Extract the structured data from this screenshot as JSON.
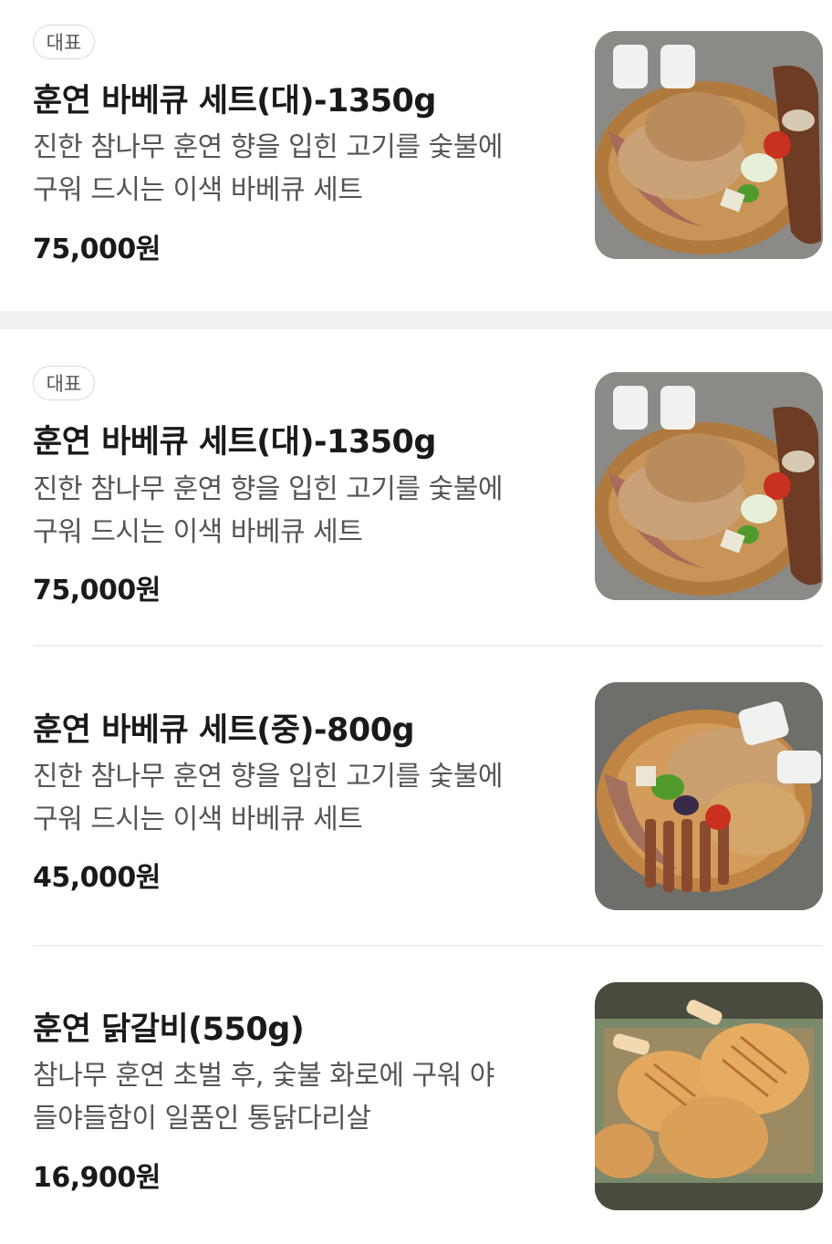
{
  "items": [
    {
      "badge": "대표",
      "name": "훈연 바베큐 세트(대)-1350g",
      "desc_line1": "진한 참나무 훈연 향을 입힌 고기를 숯불에",
      "desc_line2": "구워 드시는 이색 바베큐 세트",
      "price": "75,000원"
    },
    {
      "badge": "대표",
      "name": "훈연 바베큐 세트(대)-1350g",
      "desc_line1": "진한 참나무 훈연 향을 입힌 고기를 숯불에",
      "desc_line2": "구워 드시는 이색 바베큐 세트",
      "price": "75,000원"
    },
    {
      "name": "훈연 바베큐 세트(중)-800g",
      "desc_line1": "진한 참나무 훈연 향을 입힌 고기를 숯불에",
      "desc_line2": "구워 드시는 이색 바베큐 세트",
      "price": "45,000원"
    },
    {
      "name": "훈연 닭갈비(550g)",
      "desc_line1": "참나무 훈연 초벌 후, 숯불 화로에 구워 야",
      "desc_line2": "들야들함이 일품인 통닭다리살",
      "price": "16,900원"
    }
  ]
}
